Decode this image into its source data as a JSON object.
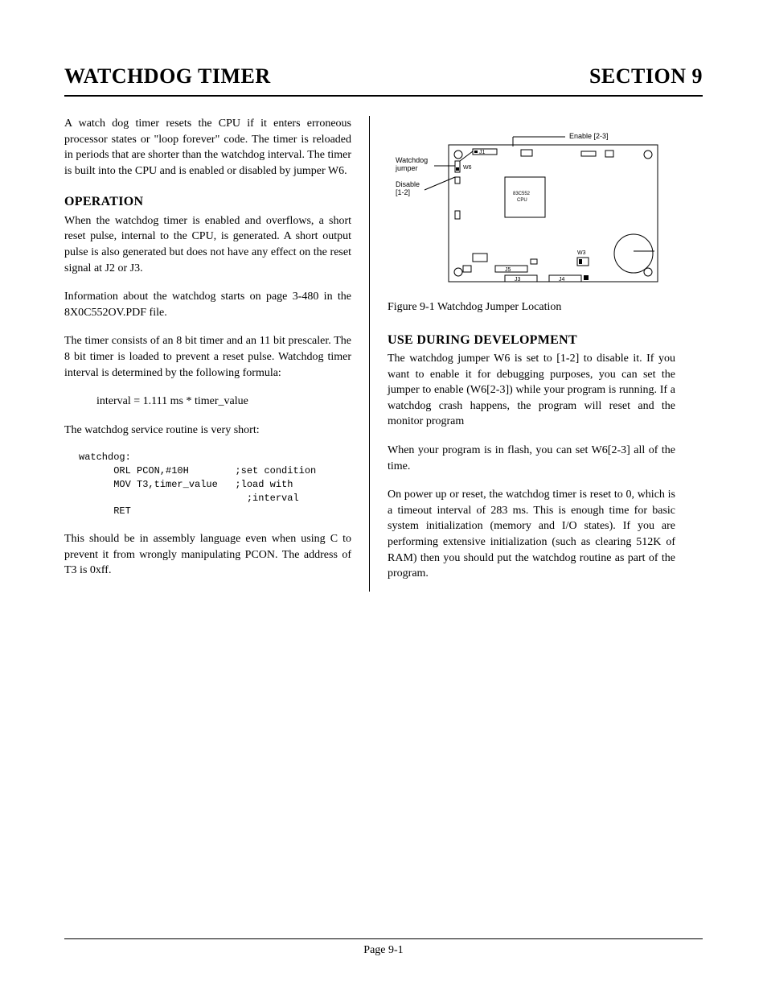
{
  "header": {
    "title_left": "WATCHDOG TIMER",
    "title_right": "SECTION 9"
  },
  "footer": {
    "page_label": "Page 9-1"
  },
  "left_col": {
    "intro": "A watch dog timer resets the CPU if it enters erroneous processor states or \"loop forever\" code. The timer is reloaded in periods that are shorter than the watchdog interval. The timer is built into the CPU and is enabled or disabled by jumper W6.",
    "operation_heading": "OPERATION",
    "op_p1": "When the watchdog timer is enabled and overflows, a short reset pulse, internal to the CPU, is generated. A short output pulse is also generated but does not have any effect on the reset signal at J2 or J3.",
    "op_p2": "Information about the watchdog starts on page 3-480 in the 8X0C552OV.PDF file.",
    "op_p3": "The timer consists of an 8 bit timer and an 11 bit prescaler. The 8 bit timer is loaded to prevent a reset pulse. Watchdog timer interval is determined by the following formula:",
    "formula": "interval =   1.111 ms * timer_value",
    "routine_intro": "The watchdog service routine is very short:",
    "code": "watchdog:\n      ORL PCON,#10H        ;set condition\n      MOV T3,timer_value   ;load with\n                             ;interval\n      RET",
    "op_p4": "This should be in assembly language even when using C to prevent it from wrongly manipulating PCON. The address of T3 is 0xff."
  },
  "right_col": {
    "figure": {
      "enable_label": "Enable [2-3]",
      "watchdog_jumper_label": "Watchdog jumper",
      "disable_label": "Disable [1-2]",
      "cpu_label": "83C552 CPU",
      "j1": "J1",
      "w6": "W6",
      "w3": "W3",
      "j5": "J5",
      "j3": "J3",
      "j4": "J4"
    },
    "caption": "Figure 9-1 Watchdog Jumper Location",
    "use_heading": "USE DURING DEVELOPMENT",
    "use_p1": "The watchdog jumper W6 is set to [1-2] to disable it. If you want to enable it for debugging purposes, you can set the jumper to enable (W6[2-3]) while your program is running. If a watchdog crash happens, the program will reset and the monitor program",
    "use_p2": "When your program is in flash, you can set W6[2-3] all of the time.",
    "use_p3": "On power up or reset, the watchdog timer is reset to 0, which is a timeout interval of 283 ms. This is enough time for basic system initialization (memory and I/O states). If you are performing extensive initialization (such as clearing 512K of RAM) then you should put the watchdog routine as part of the program."
  }
}
